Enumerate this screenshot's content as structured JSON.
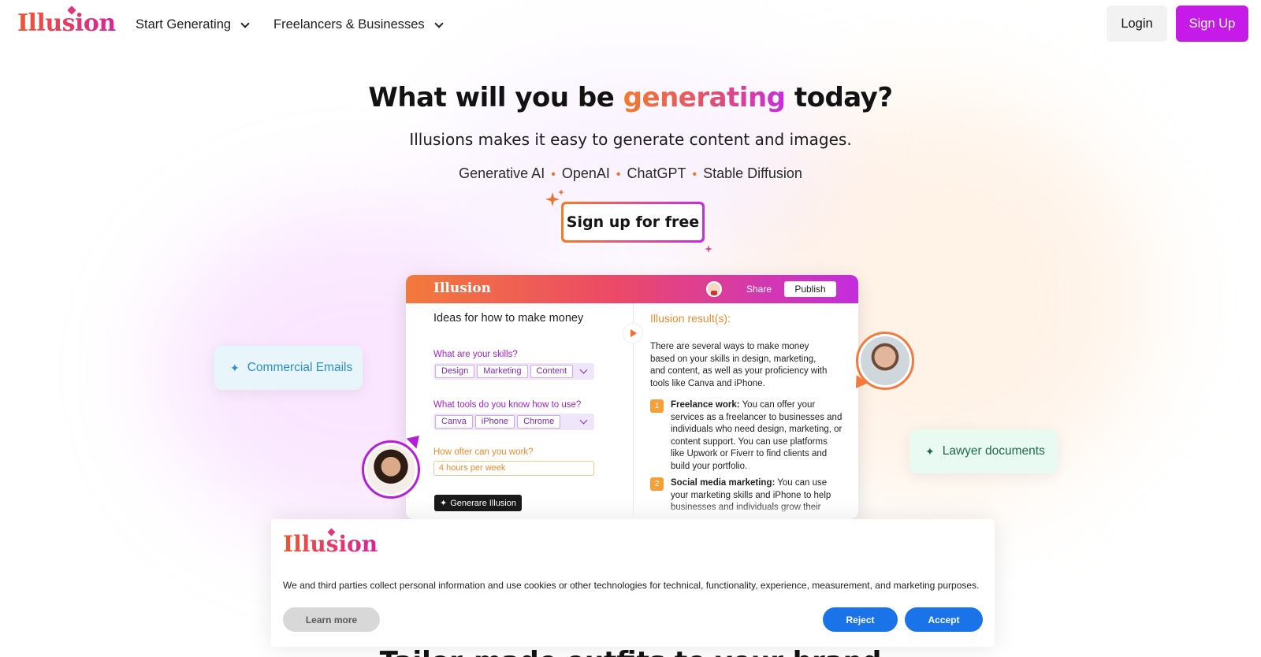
{
  "brand": {
    "logo_text": "Illusion",
    "gradient_start": "#f0562f",
    "gradient_end": "#d9239a",
    "accent_purple": "#c51ae8"
  },
  "header": {
    "nav": [
      {
        "label": "Start Generating",
        "icon": "chevron-down-icon"
      },
      {
        "label": "Freelancers & Businesses",
        "icon": "chevron-down-icon"
      }
    ],
    "login_label": "Login",
    "signup_label": "Sign Up"
  },
  "hero": {
    "title_before": "What will you be ",
    "title_highlight": "generating",
    "title_after": " today?",
    "subtitle": "Illusions makes it easy to generate content and images.",
    "tags": [
      "Generative AI",
      "OpenAI",
      "ChatGPT",
      "Stable Diffusion"
    ],
    "tag_separator": "•",
    "cta_label": "Sign up for free"
  },
  "preview": {
    "logo_text": "Illusion",
    "share_label": "Share",
    "publish_label": "Publish",
    "left_title": "Ideas for how to make money",
    "q1": "What are your skills?",
    "skills": [
      "Design",
      "Marketing",
      "Content"
    ],
    "q2": "What tools do you know how to use?",
    "tools": [
      "Canva",
      "iPhone",
      "Chrome"
    ],
    "q3": "How ofter can you work?",
    "hours_value": "4 hours per week",
    "generate_label": "Generare Illusion",
    "result_title": "Illusion result(s):",
    "result_intro": "There are several ways to make money based on your skills in design, marketing, and content, as well as your proficiency with tools like Canva and iPhone.",
    "results": [
      {
        "num": "1",
        "title": "Freelance work:",
        "text": " You can offer your services as a freelancer to businesses and individuals who need design, marketing, or content support. You can use platforms like Upwork or Fiverr to find clients and build your portfolio."
      },
      {
        "num": "2",
        "title": "Social media marketing:",
        "text": " You can use your marketing skills and iPhone to help businesses and individuals grow their"
      }
    ]
  },
  "pills": {
    "emails": "Commercial Emails",
    "lawyer": "Lawyer documents",
    "star": "✦"
  },
  "cookie": {
    "logo_text": "Illusion",
    "text": "We and third parties collect personal information and use cookies or other technologies for technical, functionality, experience, measurement, and marketing purposes.",
    "learn_more": "Learn more",
    "reject": "Reject",
    "accept": "Accept",
    "button_color": "#1a73e8"
  },
  "below_fold_heading": "Tailor-made outfits to your brand"
}
